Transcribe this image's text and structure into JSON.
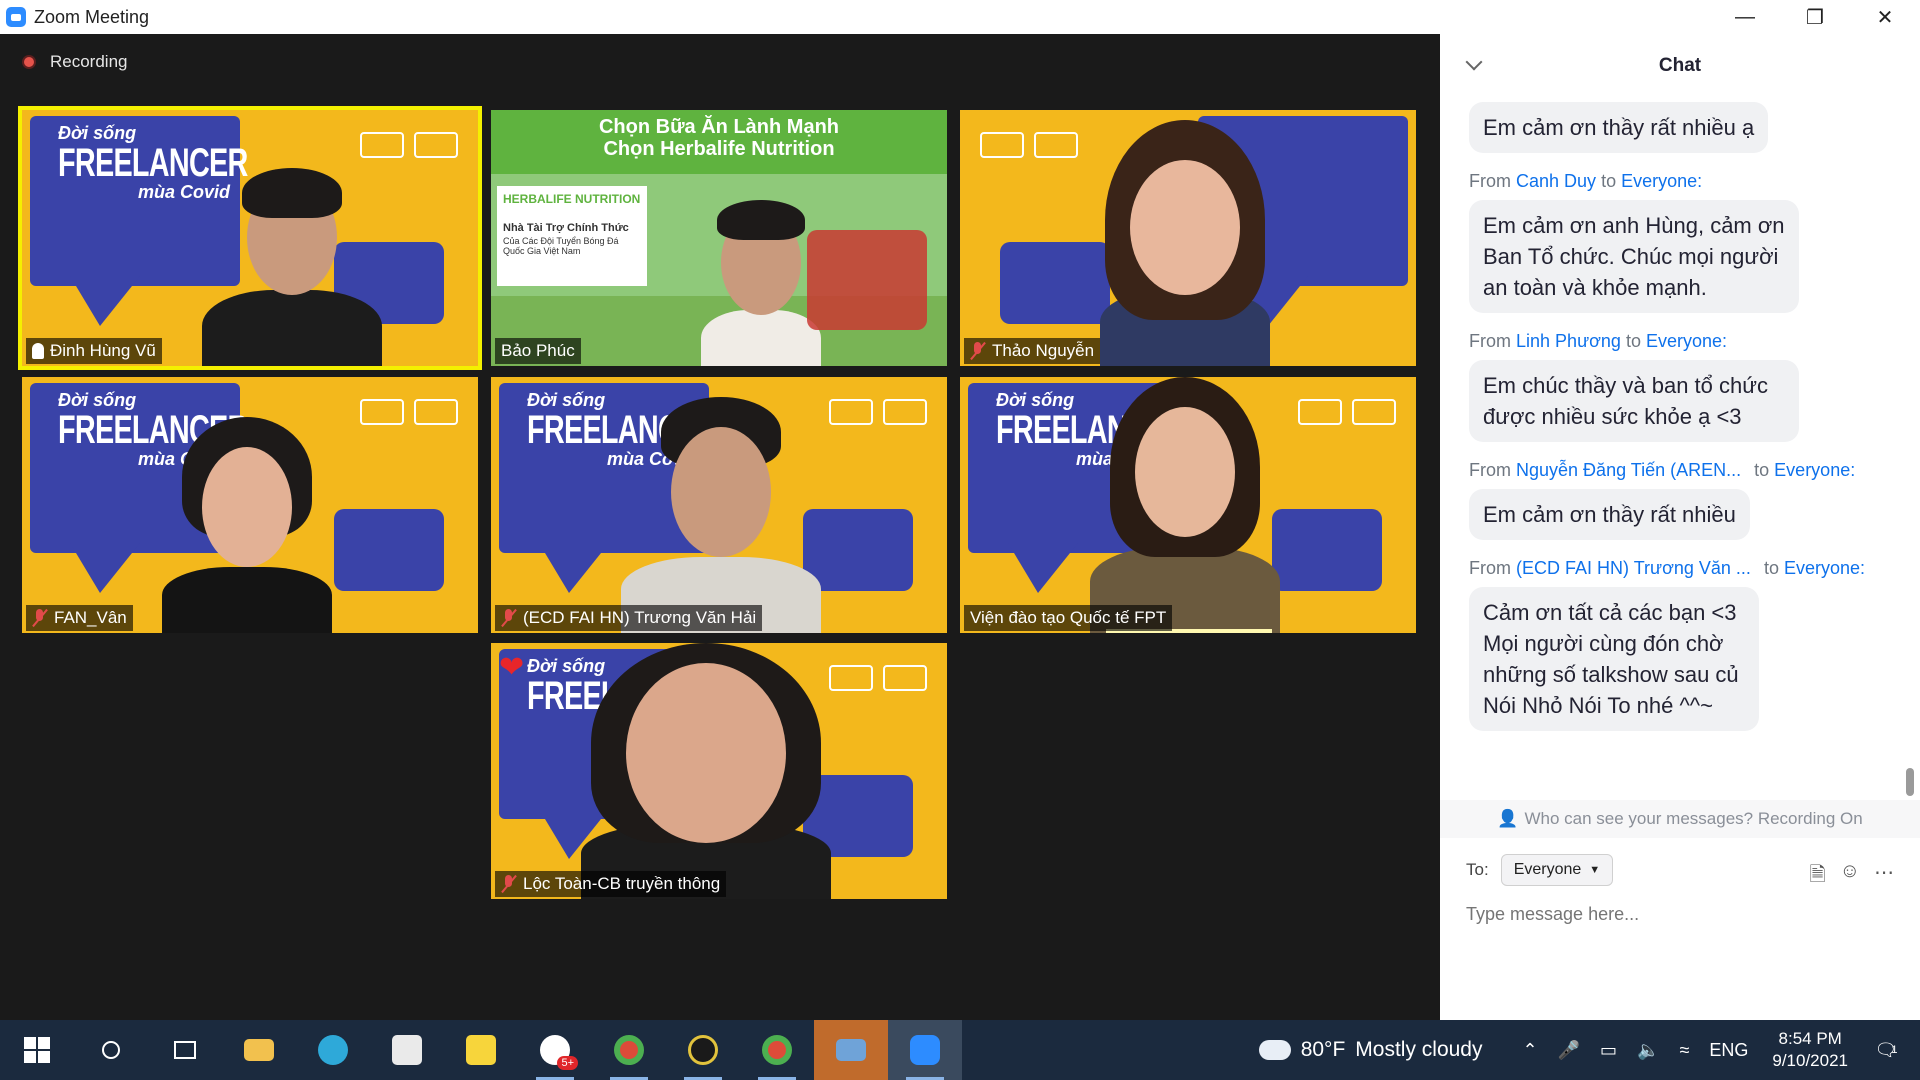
{
  "window": {
    "title": "Zoom Meeting",
    "controls": [
      "minimize",
      "restore",
      "close"
    ]
  },
  "recording": {
    "label": "Recording"
  },
  "participants": [
    {
      "name": "Đinh Hùng Vũ",
      "pinned": true,
      "muted": false,
      "active_speaker": true
    },
    {
      "name": "Bảo Phúc",
      "muted": false
    },
    {
      "name": "Thảo Nguyễn",
      "muted": true
    },
    {
      "name": "FAN_Vân",
      "muted": true
    },
    {
      "name": "(ECD FAI HN) Trương Văn Hải",
      "muted": true
    },
    {
      "name": "Viện đào tạo Quốc tế FPT",
      "muted": false
    },
    {
      "name": "Lộc Toàn-CB truyền thông",
      "muted": true,
      "reaction": "heart"
    }
  ],
  "background": {
    "brand_line1": "Đời sống",
    "brand_line2": "FREELANCER",
    "brand_line3": "mùa Covid",
    "herbalife_banner_line1": "Chọn Bữa Ăn Lành Mạnh",
    "herbalife_banner_line2": "Chọn Herbalife Nutrition",
    "herbalife_logo": "HERBALIFE NUTRITION",
    "herbalife_sponsor": "Nhà Tài Trợ Chính Thức",
    "herbalife_sponsor_sub": "Của Các Đội Tuyển Bóng Đá Quốc Gia Việt Nam"
  },
  "chat": {
    "title": "Chat",
    "from_label": "From",
    "to_label_inline": "to",
    "messages": [
      {
        "from": "",
        "to": "",
        "text": "Em cảm ơn thầy rất nhiều ạ"
      },
      {
        "from": "Canh Duy",
        "to": "Everyone:",
        "text": "Em cảm ơn anh Hùng, cảm ơn Ban Tổ chức. Chúc mọi người an toàn và khỏe mạnh."
      },
      {
        "from": "Linh Phương",
        "to": "Everyone:",
        "text": "Em chúc thầy và ban tổ chức được nhiều sức khỏe ạ <3"
      },
      {
        "from": "Nguyễn Đăng Tiến (AREN...",
        "to": "Everyone:",
        "text": "Em cảm ơn thầy rất nhiều"
      },
      {
        "from": "(ECD FAI HN) Trương Văn ...",
        "to": "Everyone:",
        "text": "Cảm ơn tất cả các bạn <3 Mọi người cùng đón chờ những số talkshow sau củ Nói Nhỏ Nói To nhé ^^~"
      }
    ],
    "privacy_notice": "Who can see your messages? Recording On",
    "to_label": "To:",
    "recipient": "Everyone",
    "input_placeholder": "Type message here...",
    "icons": [
      "file-icon",
      "emoji-icon",
      "more-icon"
    ]
  },
  "taskbar": {
    "apps": [
      "start",
      "search",
      "task-view",
      "file-explorer",
      "edge",
      "store",
      "sticky-notes",
      "zalo",
      "chrome",
      "app-circle",
      "chrome-2",
      "photos",
      "zoom"
    ],
    "zalo_badge": "5+",
    "weather_temp": "80°F",
    "weather_desc": "Mostly cloudy",
    "language": "ENG",
    "time": "8:54 PM",
    "date": "9/10/2021",
    "notification_count": "1"
  },
  "colors": {
    "zoom_blue": "#2d8cff",
    "tile_yellow": "#f3b81c",
    "brand_blue": "#3a43a8",
    "active_speaker": "#f4f000",
    "link_blue": "#0e71eb",
    "taskbar": "#1b2a3e"
  }
}
